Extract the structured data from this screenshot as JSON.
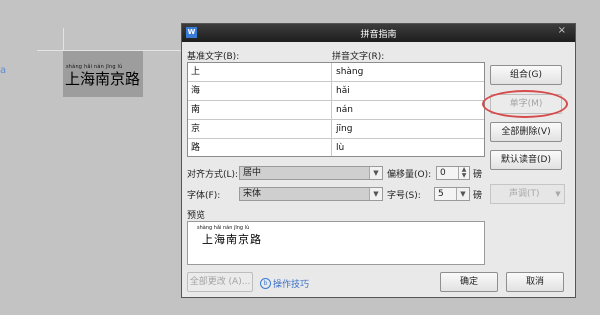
{
  "document": {
    "pinyin_ruby": "shàng hǎi  nán jīng lù",
    "text": "上海南京路",
    "side_mark": "a"
  },
  "dialog": {
    "app_icon": "W",
    "title": "拼音指南",
    "close_symbol": "×",
    "base_text_header": "基准文字(B):",
    "pinyin_text_header": "拼音文字(R):",
    "rows": [
      {
        "base": "上",
        "pinyin": "shàng"
      },
      {
        "base": "海",
        "pinyin": "hǎi"
      },
      {
        "base": "南",
        "pinyin": "nán"
      },
      {
        "base": "京",
        "pinyin": "jīng"
      },
      {
        "base": "路",
        "pinyin": "lù"
      }
    ],
    "buttons": {
      "group": "组合(G)",
      "single": "单字(M)",
      "delete_all": "全部删除(V)",
      "default_reading": "默认读音(D)",
      "tone": "声调(T)",
      "change_all": "全部更改 (A)...",
      "ok": "确定",
      "cancel": "取消"
    },
    "alignment_label": "对齐方式(L):",
    "alignment_value": "居中",
    "offset_label": "偏移量(O):",
    "offset_value": "0",
    "offset_unit": "磅",
    "font_label": "字体(F):",
    "font_value": "宋体",
    "size_label": "字号(S):",
    "size_value": "5",
    "size_unit": "磅",
    "preview_label": "预览",
    "preview_ruby": "shàng hǎi nán jīng lù",
    "preview_text": "上海南京路",
    "tips_link": "操作技巧",
    "highlight_color": "#d64b4b",
    "link_color": "#3a6fc4"
  }
}
